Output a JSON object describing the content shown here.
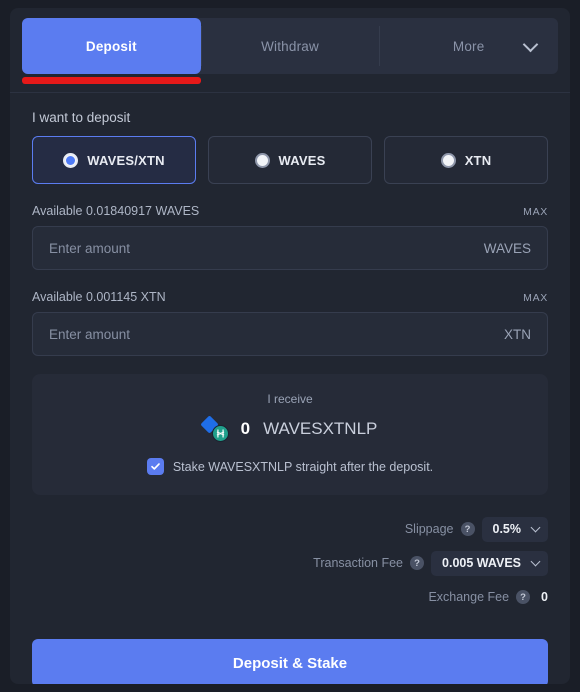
{
  "tabs": [
    {
      "label": "Deposit",
      "active": true
    },
    {
      "label": "Withdraw",
      "active": false
    },
    {
      "label": "More",
      "active": false,
      "has_caret": true
    }
  ],
  "form": {
    "section_label": "I want to deposit",
    "options": [
      {
        "label": "WAVES/XTN",
        "selected": true
      },
      {
        "label": "WAVES",
        "selected": false
      },
      {
        "label": "XTN",
        "selected": false
      }
    ],
    "amount_rows": [
      {
        "available": "Available 0.01840917 WAVES",
        "max_label": "MAX",
        "placeholder": "Enter amount",
        "value": "",
        "unit": "WAVES"
      },
      {
        "available": "Available 0.001145 XTN",
        "max_label": "MAX",
        "placeholder": "Enter amount",
        "value": "",
        "unit": "XTN"
      }
    ]
  },
  "receive": {
    "label": "I receive",
    "amount": "0",
    "token": "WAVESXTNLP",
    "stake_label": "Stake WAVESXTNLP straight after the deposit.",
    "stake_checked": true
  },
  "fees": [
    {
      "name": "Slippage",
      "help": "?",
      "value": "0.5%",
      "type": "select"
    },
    {
      "name": "Transaction Fee",
      "help": "?",
      "value": "0.005 WAVES",
      "type": "select"
    },
    {
      "name": "Exchange Fee",
      "help": "?",
      "value": "0",
      "type": "plain"
    }
  ],
  "submit": {
    "label": "Deposit & Stake"
  },
  "colors": {
    "accent": "#5b7cf0",
    "underline": "#e61919",
    "card_bg": "#212631",
    "panel_bg": "#262b38",
    "page_bg": "#1a1e27",
    "waves_icon": "#1f6ee8",
    "xtn_icon": "#20a08c"
  }
}
